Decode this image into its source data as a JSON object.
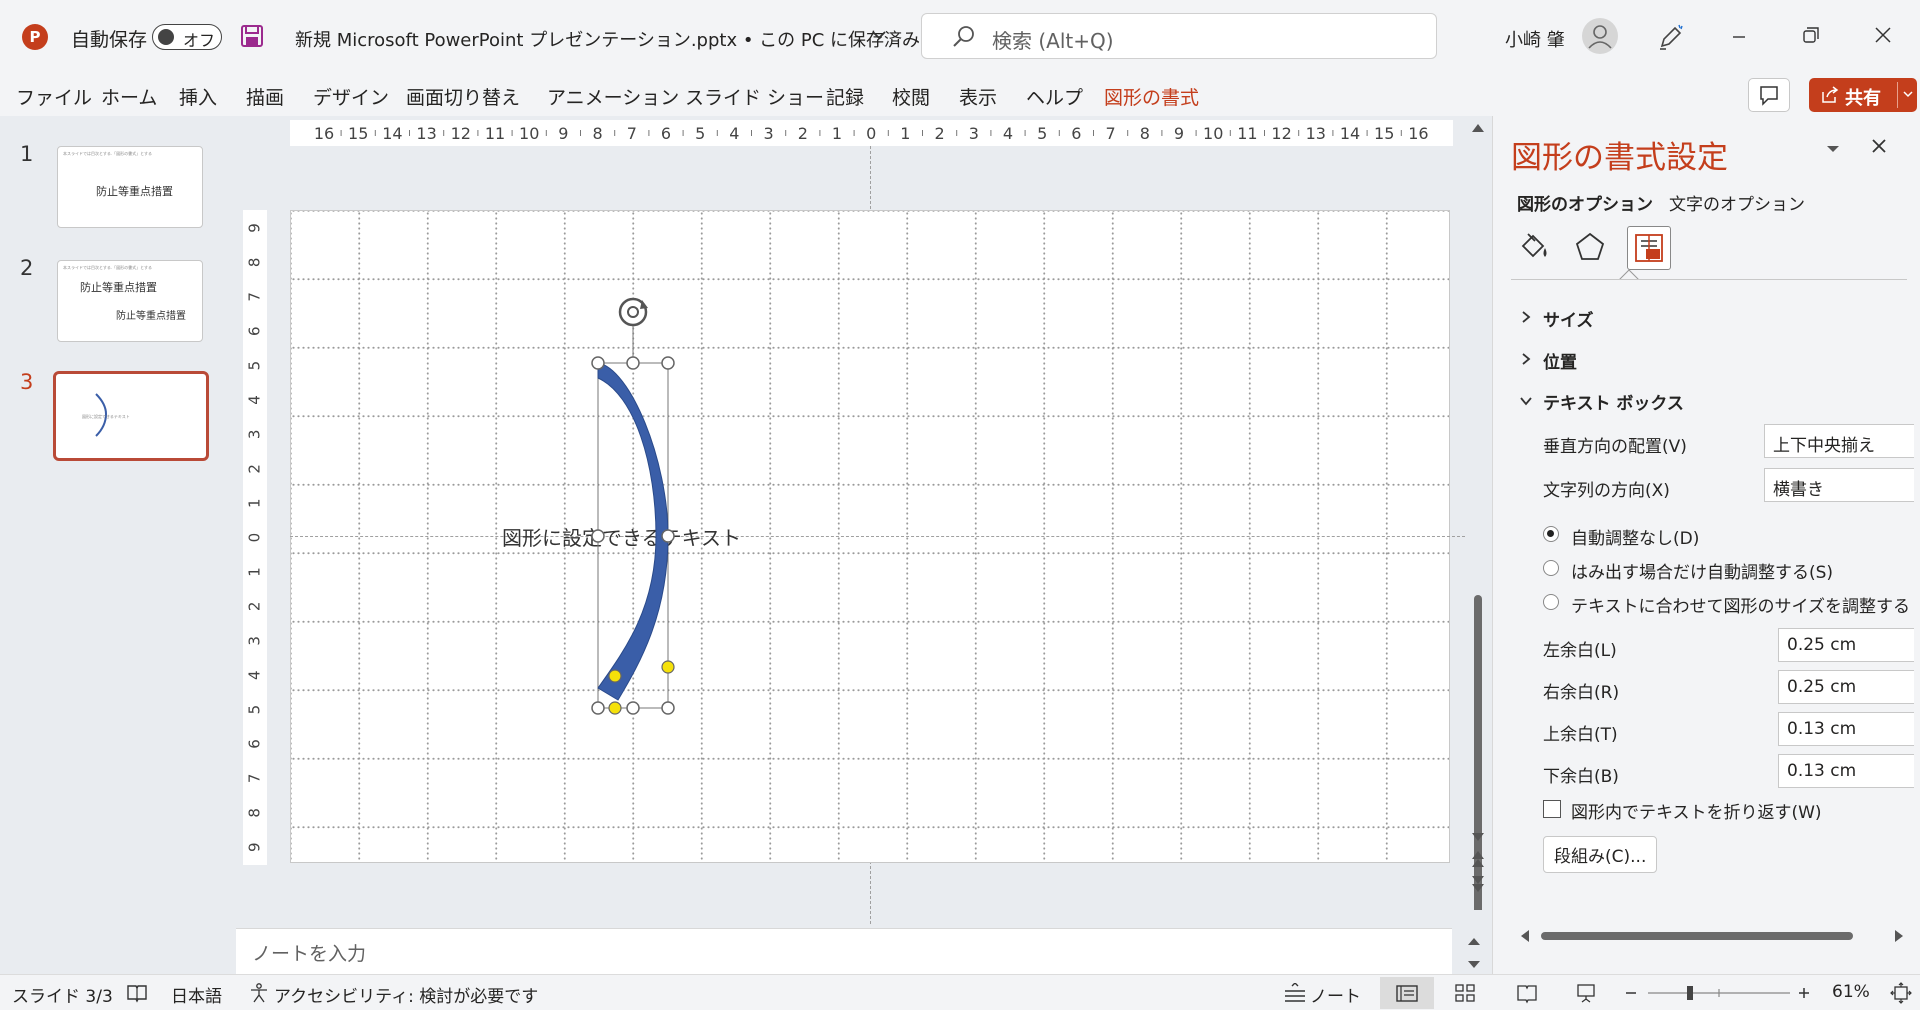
{
  "titlebar": {
    "autosave_label": "自動保存",
    "autosave_state": "オフ",
    "doc_title": "新規 Microsoft PowerPoint プレゼンテーション.pptx • この PC に保存済み",
    "search_placeholder": "検索 (Alt+Q)",
    "user_name": "小崎 肇",
    "app_icon_letter": "P"
  },
  "menu": {
    "items": [
      "ファイル",
      "ホーム",
      "挿入",
      "描画",
      "デザイン",
      "画面切り替え",
      "アニメーション",
      "スライド ショー",
      "記録",
      "校閲",
      "表示",
      "ヘルプ",
      "図形の書式"
    ],
    "share_label": "共有"
  },
  "thumbnails": [
    {
      "number": "1",
      "lines": [
        "防止等重点措置"
      ],
      "header": "本スライドでは目次とする.「図形の書式」とする"
    },
    {
      "number": "2",
      "lines": [
        "防止等重点措置",
        "防止等重点措置"
      ],
      "header": "本スライドでは目次とする.「図形の書式」とする"
    },
    {
      "number": "3",
      "lines": [],
      "tiny": "図形に設定できるテキスト"
    }
  ],
  "rulers": {
    "horizontal": [
      "16",
      "15",
      "14",
      "13",
      "12",
      "11",
      "10",
      "9",
      "8",
      "7",
      "6",
      "5",
      "4",
      "3",
      "2",
      "1",
      "0",
      "1",
      "2",
      "3",
      "4",
      "5",
      "6",
      "7",
      "8",
      "9",
      "10",
      "11",
      "12",
      "13",
      "14",
      "15",
      "16"
    ],
    "vertical": [
      "9",
      "8",
      "7",
      "6",
      "5",
      "4",
      "3",
      "2",
      "1",
      "0",
      "1",
      "2",
      "3",
      "4",
      "5",
      "6",
      "7",
      "8",
      "9"
    ]
  },
  "slide": {
    "shape_text": "図形に設定できるテキスト"
  },
  "notes_placeholder": "ノートを入力",
  "pane": {
    "title": "図形の書式設定",
    "tab_shape": "図形のオプション",
    "tab_text": "文字のオプション",
    "section_size": "サイズ",
    "section_position": "位置",
    "section_textbox": "テキスト ボックス",
    "valign_label": "垂直方向の配置(V)",
    "valign_value": "上下中央揃え",
    "direction_label": "文字列の方向(X)",
    "direction_value": "横書き",
    "radio_no_autofit": "自動調整なし(D)",
    "radio_shrink": "はみ出す場合だけ自動調整する(S)",
    "radio_resize": "テキストに合わせて図形のサイズを調整する",
    "margin_left_label": "左余白(L)",
    "margin_left_value": "0.25 cm",
    "margin_right_label": "右余白(R)",
    "margin_right_value": "0.25 cm",
    "margin_top_label": "上余白(T)",
    "margin_top_value": "0.13 cm",
    "margin_bottom_label": "下余白(B)",
    "margin_bottom_value": "0.13 cm",
    "wrap_label": "図形内でテキストを折り返す(W)",
    "columns_button": "段組み(C)..."
  },
  "status": {
    "slide_counter": "スライド 3/3",
    "language": "日本語",
    "accessibility": "アクセシビリティ: 検討が必要です",
    "notes_button": "ノート",
    "zoom": "61%"
  },
  "colors": {
    "accent": "#c43e1c",
    "shape_fill": "#3a5ea8",
    "handle_yellow": "#f5e10a"
  }
}
